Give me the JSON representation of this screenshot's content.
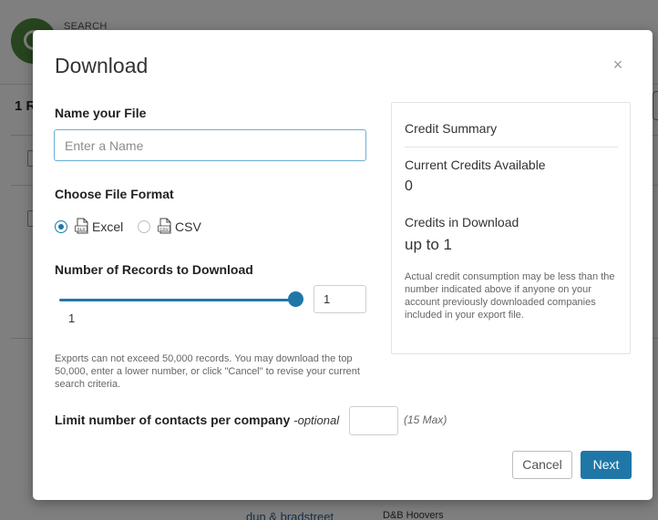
{
  "background": {
    "search_label": "SEARCH",
    "result_count": "1 R",
    "footer_logo": "dun & bradstreet",
    "footer_text": "D&B Hoovers"
  },
  "modal": {
    "title": "Download",
    "close_symbol": "×"
  },
  "file_name": {
    "label": "Name your File",
    "placeholder": "Enter a Name",
    "value": ""
  },
  "file_format": {
    "label": "Choose File Format",
    "options": [
      {
        "label": "Excel",
        "icon": "xls-file-icon",
        "icon_text": "XLS",
        "selected": true
      },
      {
        "label": "CSV",
        "icon": "csv-file-icon",
        "icon_text": "CSV",
        "selected": false
      }
    ]
  },
  "records": {
    "label": "Number of Records to Download",
    "slider_min_label": "1",
    "value": "1",
    "slider_fraction": 1.0
  },
  "export_note": "Exports can not exceed 50,000 records. You may download the top 50,000, enter a lower number, or click \"Cancel\" to revise your current search criteria.",
  "contacts_limit": {
    "label": "Limit number of contacts per company",
    "optional": "-optional",
    "max_text": "(15 Max)",
    "value": ""
  },
  "credit_summary": {
    "title": "Credit Summary",
    "available_label": "Current Credits Available",
    "available_value": "0",
    "download_label": "Credits in Download",
    "download_value": "up to 1",
    "note": "Actual credit consumption may be less than the number indicated above if anyone on your account previously downloaded companies included in your export file."
  },
  "buttons": {
    "cancel": "Cancel",
    "next": "Next"
  },
  "colors": {
    "accent": "#1f77a8",
    "input_focus_border": "#6aaed6",
    "brand_green": "#4f8a3c"
  }
}
